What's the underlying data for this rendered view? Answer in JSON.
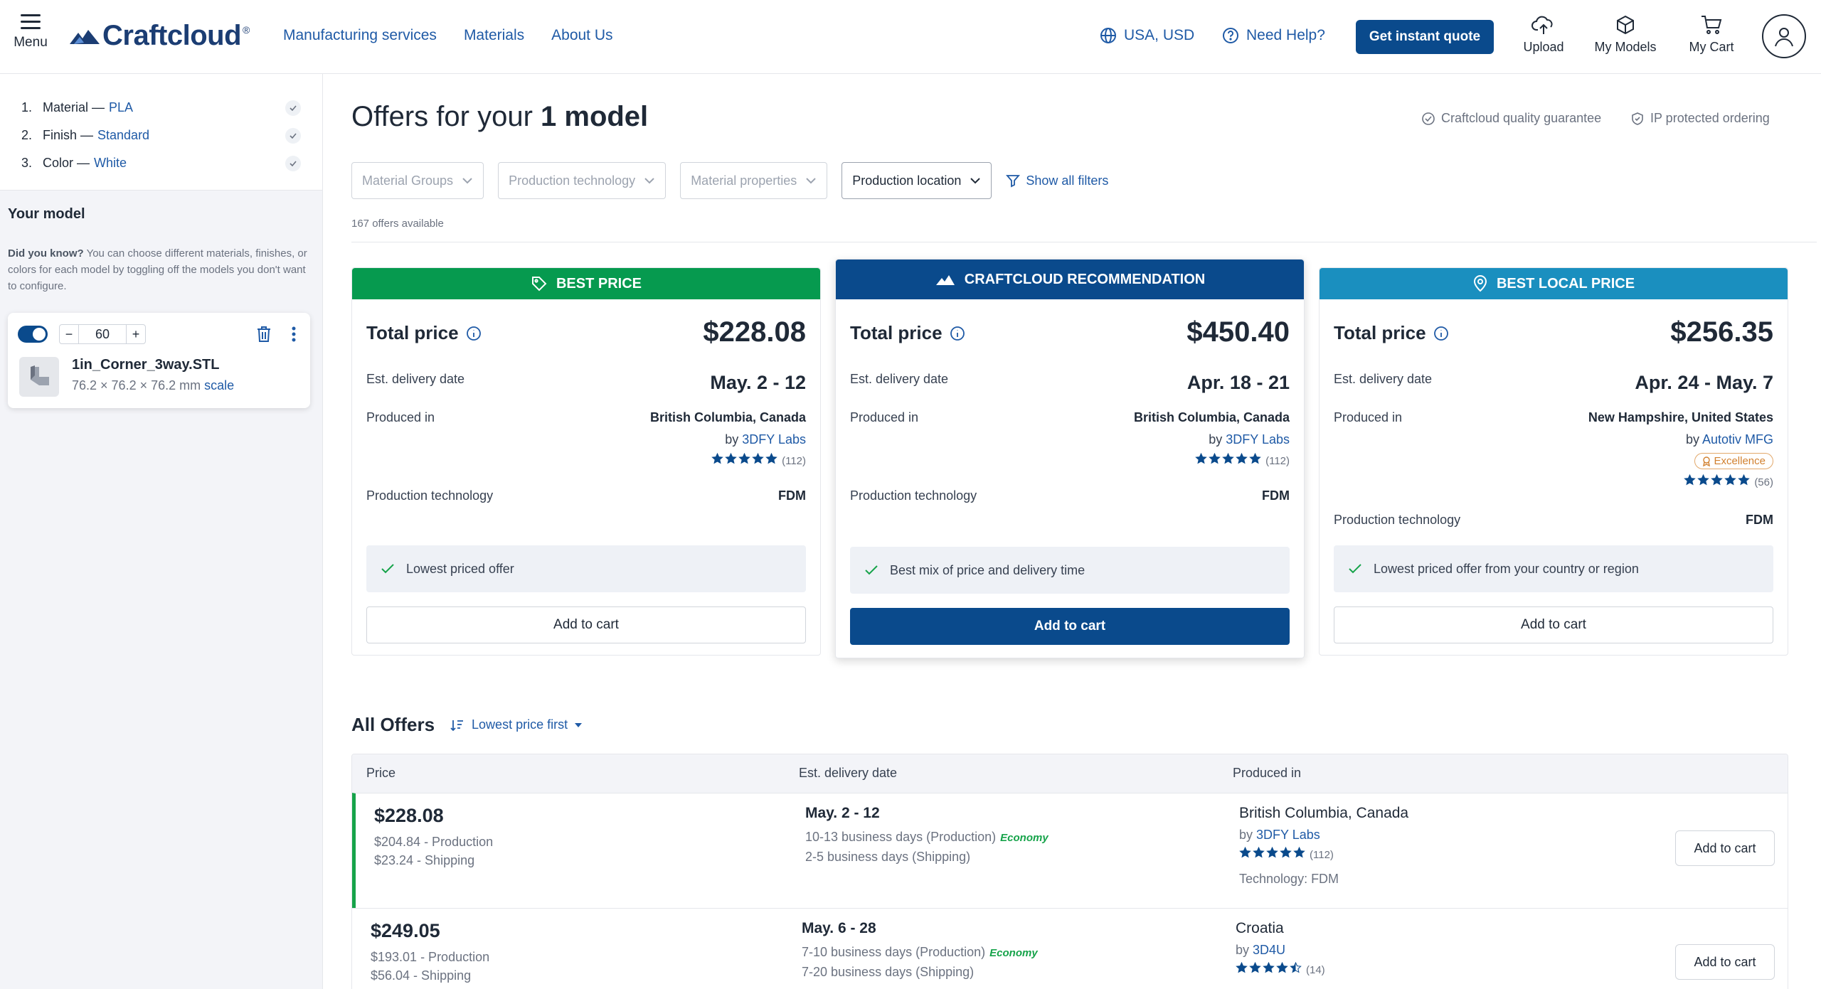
{
  "header": {
    "menu_label": "Menu",
    "logo_text": "Craftcloud",
    "logo_reg": "®",
    "nav": [
      "Manufacturing services",
      "Materials",
      "About Us"
    ],
    "region": "USA, USD",
    "help": "Need Help?",
    "quote_button": "Get instant quote",
    "tools": [
      "Upload",
      "My Models",
      "My Cart"
    ],
    "accent_color": "#0a4a8c"
  },
  "sidebar": {
    "steps": [
      {
        "num": "1.",
        "label": "Material — ",
        "value": "PLA"
      },
      {
        "num": "2.",
        "label": "Finish — ",
        "value": "Standard"
      },
      {
        "num": "3.",
        "label": "Color — ",
        "value": "White"
      }
    ],
    "your_model": "Your model",
    "tip_bold": "Did you know?",
    "tip_text": " You can choose different materials, finishes, or colors for each model by toggling off the models you don't want to configure.",
    "model": {
      "quantity": "60",
      "name": "1in_Corner_3way.STL",
      "dims": "76.2 × 76.2 × 76.2 mm",
      "scale": "scale"
    }
  },
  "main": {
    "title_prefix": "Offers for your ",
    "title_bold": "1 model",
    "guarantees": [
      "Craftcloud quality guarantee",
      "IP protected ordering"
    ],
    "filters": [
      "Material Groups",
      "Production technology",
      "Material properties",
      "Production location"
    ],
    "show_filters": "Show all filters",
    "offers_count": "167 offers available"
  },
  "cards": [
    {
      "header": "BEST PRICE",
      "header_color": "#069a4f",
      "total_label": "Total price",
      "total": "$228.08",
      "delivery_label": "Est. delivery date",
      "delivery": "May. 2 - 12",
      "produced_label": "Produced in",
      "location": "British Columbia, Canada",
      "by_prefix": "by ",
      "vendor": "3DFY Labs",
      "rating": 5,
      "reviews": "(112)",
      "tech_label": "Production technology",
      "tech": "FDM",
      "note": "Lowest priced offer",
      "cart": "Add to cart"
    },
    {
      "header": "CRAFTCLOUD RECOMMENDATION",
      "header_color": "#0a4a8c",
      "total_label": "Total price",
      "total": "$450.40",
      "delivery_label": "Est. delivery date",
      "delivery": "Apr. 18 - 21",
      "produced_label": "Produced in",
      "location": "British Columbia, Canada",
      "by_prefix": "by ",
      "vendor": "3DFY Labs",
      "rating": 5,
      "reviews": "(112)",
      "tech_label": "Production technology",
      "tech": "FDM",
      "note": "Best mix of price and delivery time",
      "cart": "Add to cart"
    },
    {
      "header": "BEST LOCAL PRICE",
      "header_color": "#1a8fbf",
      "total_label": "Total price",
      "total": "$256.35",
      "delivery_label": "Est. delivery date",
      "delivery": "Apr. 24 - May. 7",
      "produced_label": "Produced in",
      "location": "New Hampshire, United States",
      "by_prefix": "by ",
      "vendor": "Autotiv MFG",
      "badge": "Excellence",
      "rating": 5,
      "reviews": "(56)",
      "tech_label": "Production technology",
      "tech": "FDM",
      "note": "Lowest priced offer from your country or region",
      "cart": "Add to cart"
    }
  ],
  "all_offers": {
    "title": "All Offers",
    "sort": "Lowest price first",
    "columns": [
      "Price",
      "Est. delivery date",
      "Produced in"
    ],
    "rows": [
      {
        "price": "$228.08",
        "production": "$204.84 - Production",
        "shipping": "$23.24 - Shipping",
        "date": "May. 2 - 12",
        "prod_days": "10-13 business days (Production)",
        "eco": "Economy",
        "ship_days": "2-5 business days (Shipping)",
        "location": "British Columbia, Canada",
        "by_prefix": "by ",
        "vendor": "3DFY Labs",
        "rating": 5,
        "reviews": "(112)",
        "tech": "Technology: FDM",
        "cart": "Add to cart"
      },
      {
        "price": "$249.05",
        "production": "$193.01 - Production",
        "shipping": "$56.04 - Shipping",
        "date": "May. 6 - 28",
        "prod_days": "7-10 business days (Production)",
        "eco": "Economy",
        "ship_days": "7-20 business days (Shipping)",
        "location": "Croatia",
        "by_prefix": "by ",
        "vendor": "3D4U",
        "rating": 4.5,
        "reviews": "(14)",
        "cart": "Add to cart"
      }
    ]
  }
}
